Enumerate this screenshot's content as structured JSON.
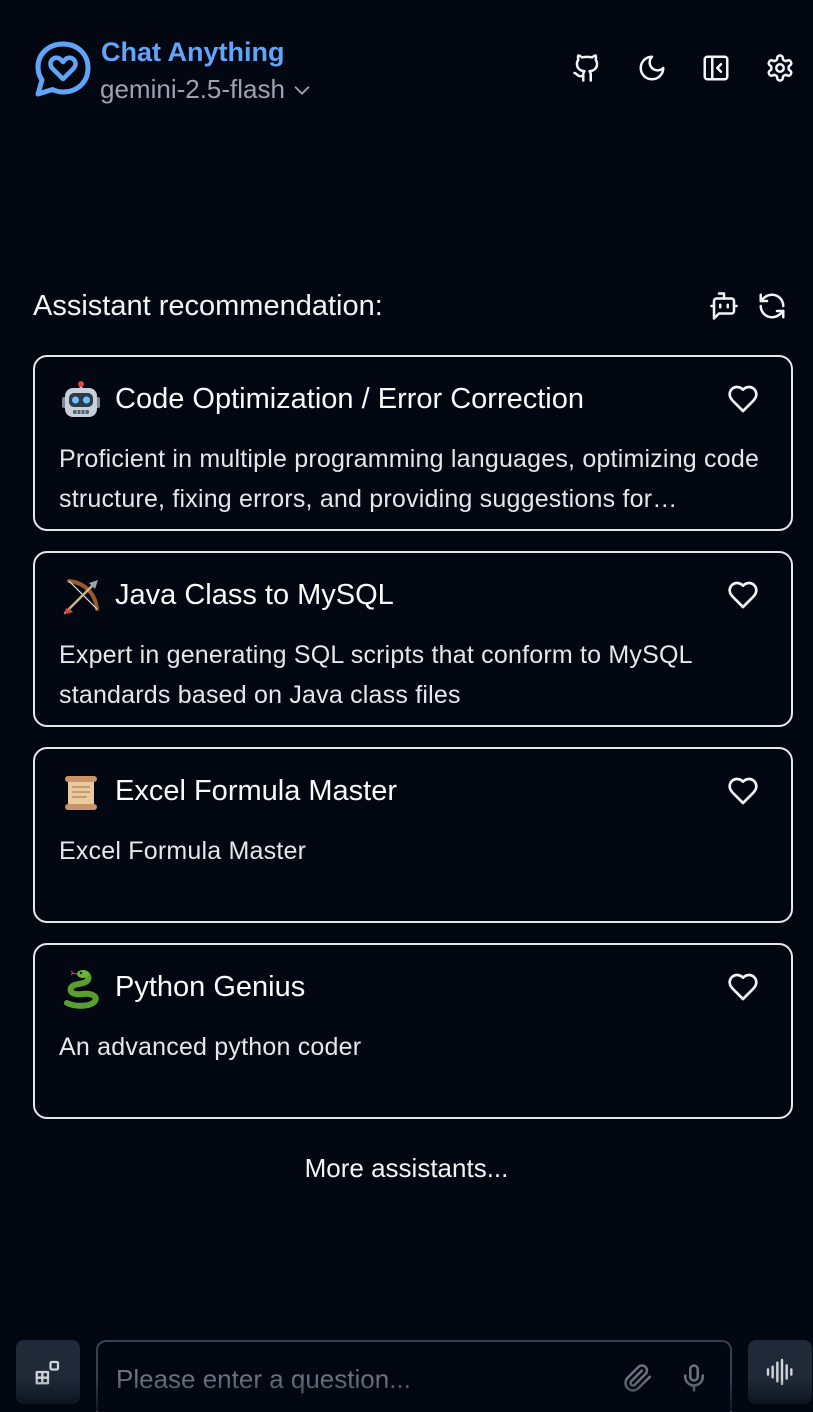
{
  "header": {
    "app_title": "Chat Anything",
    "model": "gemini-2.5-flash",
    "icons": [
      "chat-heart-logo",
      "github-icon",
      "moon-icon",
      "sidebar-collapse-icon",
      "gear-icon"
    ]
  },
  "recommendations": {
    "title": "Assistant recommendation:",
    "icons": [
      "bot-icon",
      "refresh-icon"
    ],
    "cards": [
      {
        "emoji": "robot",
        "title": "Code Optimization / Error Correction",
        "description": "Proficient in multiple programming languages, optimizing code structure, fixing errors, and providing suggestions for improvement."
      },
      {
        "emoji": "bow-and-arrow",
        "title": "Java Class to MySQL",
        "description": "Expert in generating SQL scripts that conform to MySQL standards based on Java class files"
      },
      {
        "emoji": "scroll",
        "title": "Excel Formula Master",
        "description": "Excel Formula Master"
      },
      {
        "emoji": "snake",
        "title": "Python Genius",
        "description": "An advanced python coder"
      }
    ],
    "more_label": "More assistants..."
  },
  "composer": {
    "placeholder": "Please enter a question...",
    "icons": [
      "tools-grid-icon",
      "paperclip-icon",
      "microphone-icon",
      "voice-wave-icon"
    ]
  },
  "colors": {
    "background": "#030712",
    "accent": "#60a5fa",
    "muted": "#9ca3af",
    "card_border": "#e5e7eb"
  }
}
